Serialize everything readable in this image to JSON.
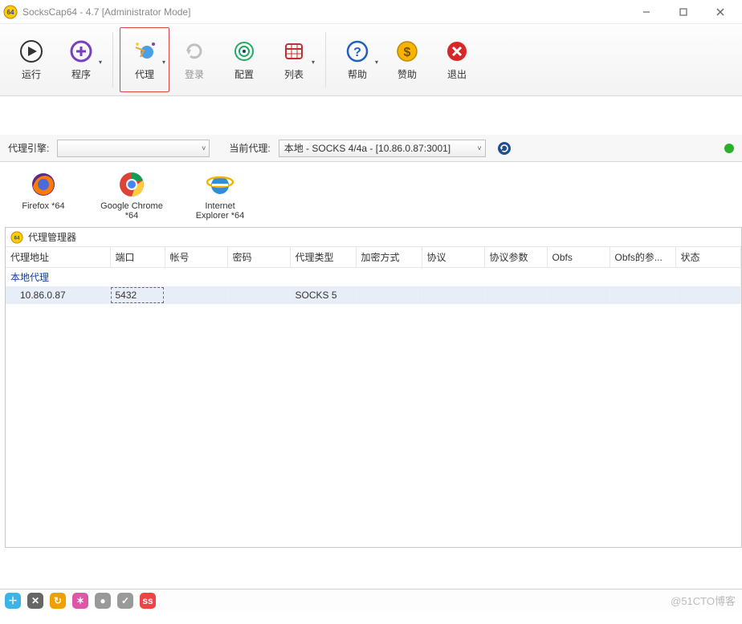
{
  "window": {
    "title": "SocksCap64 - 4.7 [Administrator Mode]"
  },
  "toolbar": {
    "run": "运行",
    "programs": "程序",
    "proxy": "代理",
    "login": "登录",
    "config": "配置",
    "list": "列表",
    "help": "帮助",
    "sponsor": "赞助",
    "exit": "退出"
  },
  "engine_bar": {
    "engine_label": "代理引擎:",
    "engine_value": "",
    "current_label": "当前代理:",
    "current_value": "本地 - SOCKS 4/4a - [10.86.0.87:3001]"
  },
  "shortcuts": [
    {
      "name": "Firefox *64"
    },
    {
      "name": "Google Chrome *64"
    },
    {
      "name": "Internet Explorer *64"
    }
  ],
  "proxy_manager": {
    "title": "代理管理器",
    "columns": [
      "代理地址",
      "端口",
      "帐号",
      "密码",
      "代理类型",
      "加密方式",
      "协议",
      "协议参数",
      "Obfs",
      "Obfs的参...",
      "状态"
    ],
    "group_label": "本地代理",
    "rows": [
      {
        "address": "10.86.0.87",
        "port": "5432",
        "account": "",
        "password": "",
        "type": "SOCKS 5",
        "encrypt": "",
        "protocol": "",
        "protocol_args": "",
        "obfs": "",
        "obfs_args": "",
        "status": ""
      }
    ]
  },
  "watermark": "@51CTO博客"
}
